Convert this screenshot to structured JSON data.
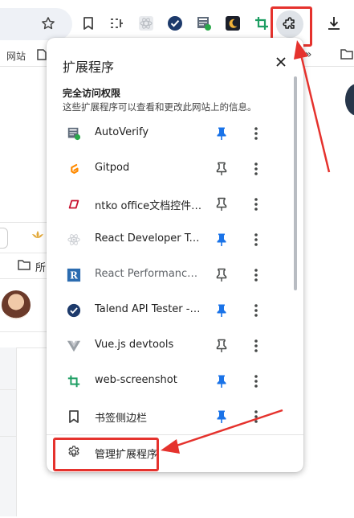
{
  "toolbar": {
    "icons": [
      "star-icon",
      "bookmark-icon",
      "tab-search-icon",
      "react-icon",
      "talend-icon",
      "autoverify-icon",
      "extension-moon-icon",
      "web-screenshot-icon",
      "extensions-puzzle-icon",
      "download-icon"
    ]
  },
  "bookmarks_bar": {
    "item_label": "网站"
  },
  "left_page": {
    "folder_label": "所"
  },
  "popup": {
    "title": "扩展程序",
    "section_title": "完全访问权限",
    "section_subtitle": "这些扩展程序可以查看和更改此网站上的信息。",
    "extensions": [
      {
        "name": "AutoVerify",
        "icon": "autoverify-icon",
        "pinned": true,
        "dim": false
      },
      {
        "name": "Gitpod",
        "icon": "gitpod-icon",
        "pinned": false,
        "dim": false
      },
      {
        "name": "ntko office文档控件浏...",
        "icon": "ntko-icon",
        "pinned": false,
        "dim": false
      },
      {
        "name": "React Developer Tools",
        "icon": "react-icon",
        "pinned": true,
        "dim": false
      },
      {
        "name": "React Performance D...",
        "icon": "react-perf-icon",
        "pinned": false,
        "dim": true
      },
      {
        "name": "Talend API Tester - Fr...",
        "icon": "talend-icon",
        "pinned": true,
        "dim": false
      },
      {
        "name": "Vue.js devtools",
        "icon": "vue-icon",
        "pinned": false,
        "dim": false
      },
      {
        "name": "web-screenshot",
        "icon": "web-screenshot-icon",
        "pinned": true,
        "dim": false
      },
      {
        "name": "书签侧边栏",
        "icon": "bookmark-sidebar-icon",
        "pinned": true,
        "dim": false
      }
    ],
    "manage_label": "管理扩展程序"
  },
  "colors": {
    "pin_active": "#1a73e8",
    "pin_inactive": "#444746",
    "annotation_red": "#e5322d",
    "accent_green": "#1e9e63"
  }
}
